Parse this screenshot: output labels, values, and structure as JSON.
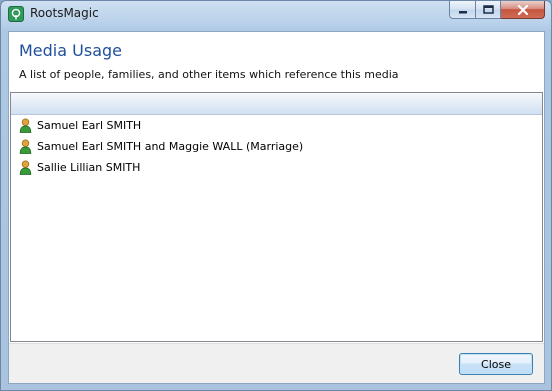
{
  "window": {
    "title": "RootsMagic",
    "app_icon": "roots-tree-icon"
  },
  "caption_buttons": {
    "minimize": "minimize-icon",
    "maximize": "maximize-icon",
    "close": "close-icon"
  },
  "dialog": {
    "heading": "Media Usage",
    "description": "A list of people, families, and other items which reference this media"
  },
  "list": {
    "items": [
      {
        "label": "Samuel Earl SMITH",
        "icon": "person-icon"
      },
      {
        "label": "Samuel Earl SMITH and Maggie WALL (Marriage)",
        "icon": "person-icon"
      },
      {
        "label": "Sallie Lillian SMITH",
        "icon": "person-icon"
      }
    ]
  },
  "footer": {
    "close_label": "Close"
  },
  "colors": {
    "heading": "#1e4f9c",
    "person_icon_head": "#e0a43a",
    "person_icon_body": "#3a9a3a"
  }
}
